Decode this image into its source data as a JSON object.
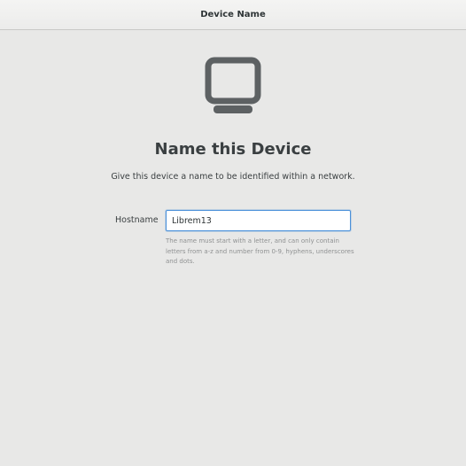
{
  "window": {
    "title": "Device Name"
  },
  "main": {
    "icon": "computer-monitor-icon",
    "heading": "Name this Device",
    "subtitle": "Give this device a name to be identified within a network.",
    "hostname": {
      "label": "Hostname",
      "value": "Librem13",
      "placeholder": ""
    },
    "hint": "The name must start with a letter, and can only contain letters from a-z and number from 0-9, hyphens, underscores and dots."
  },
  "colors": {
    "background": "#e8e8e7",
    "accent": "#4a90d9",
    "icon": "#5d6163"
  }
}
